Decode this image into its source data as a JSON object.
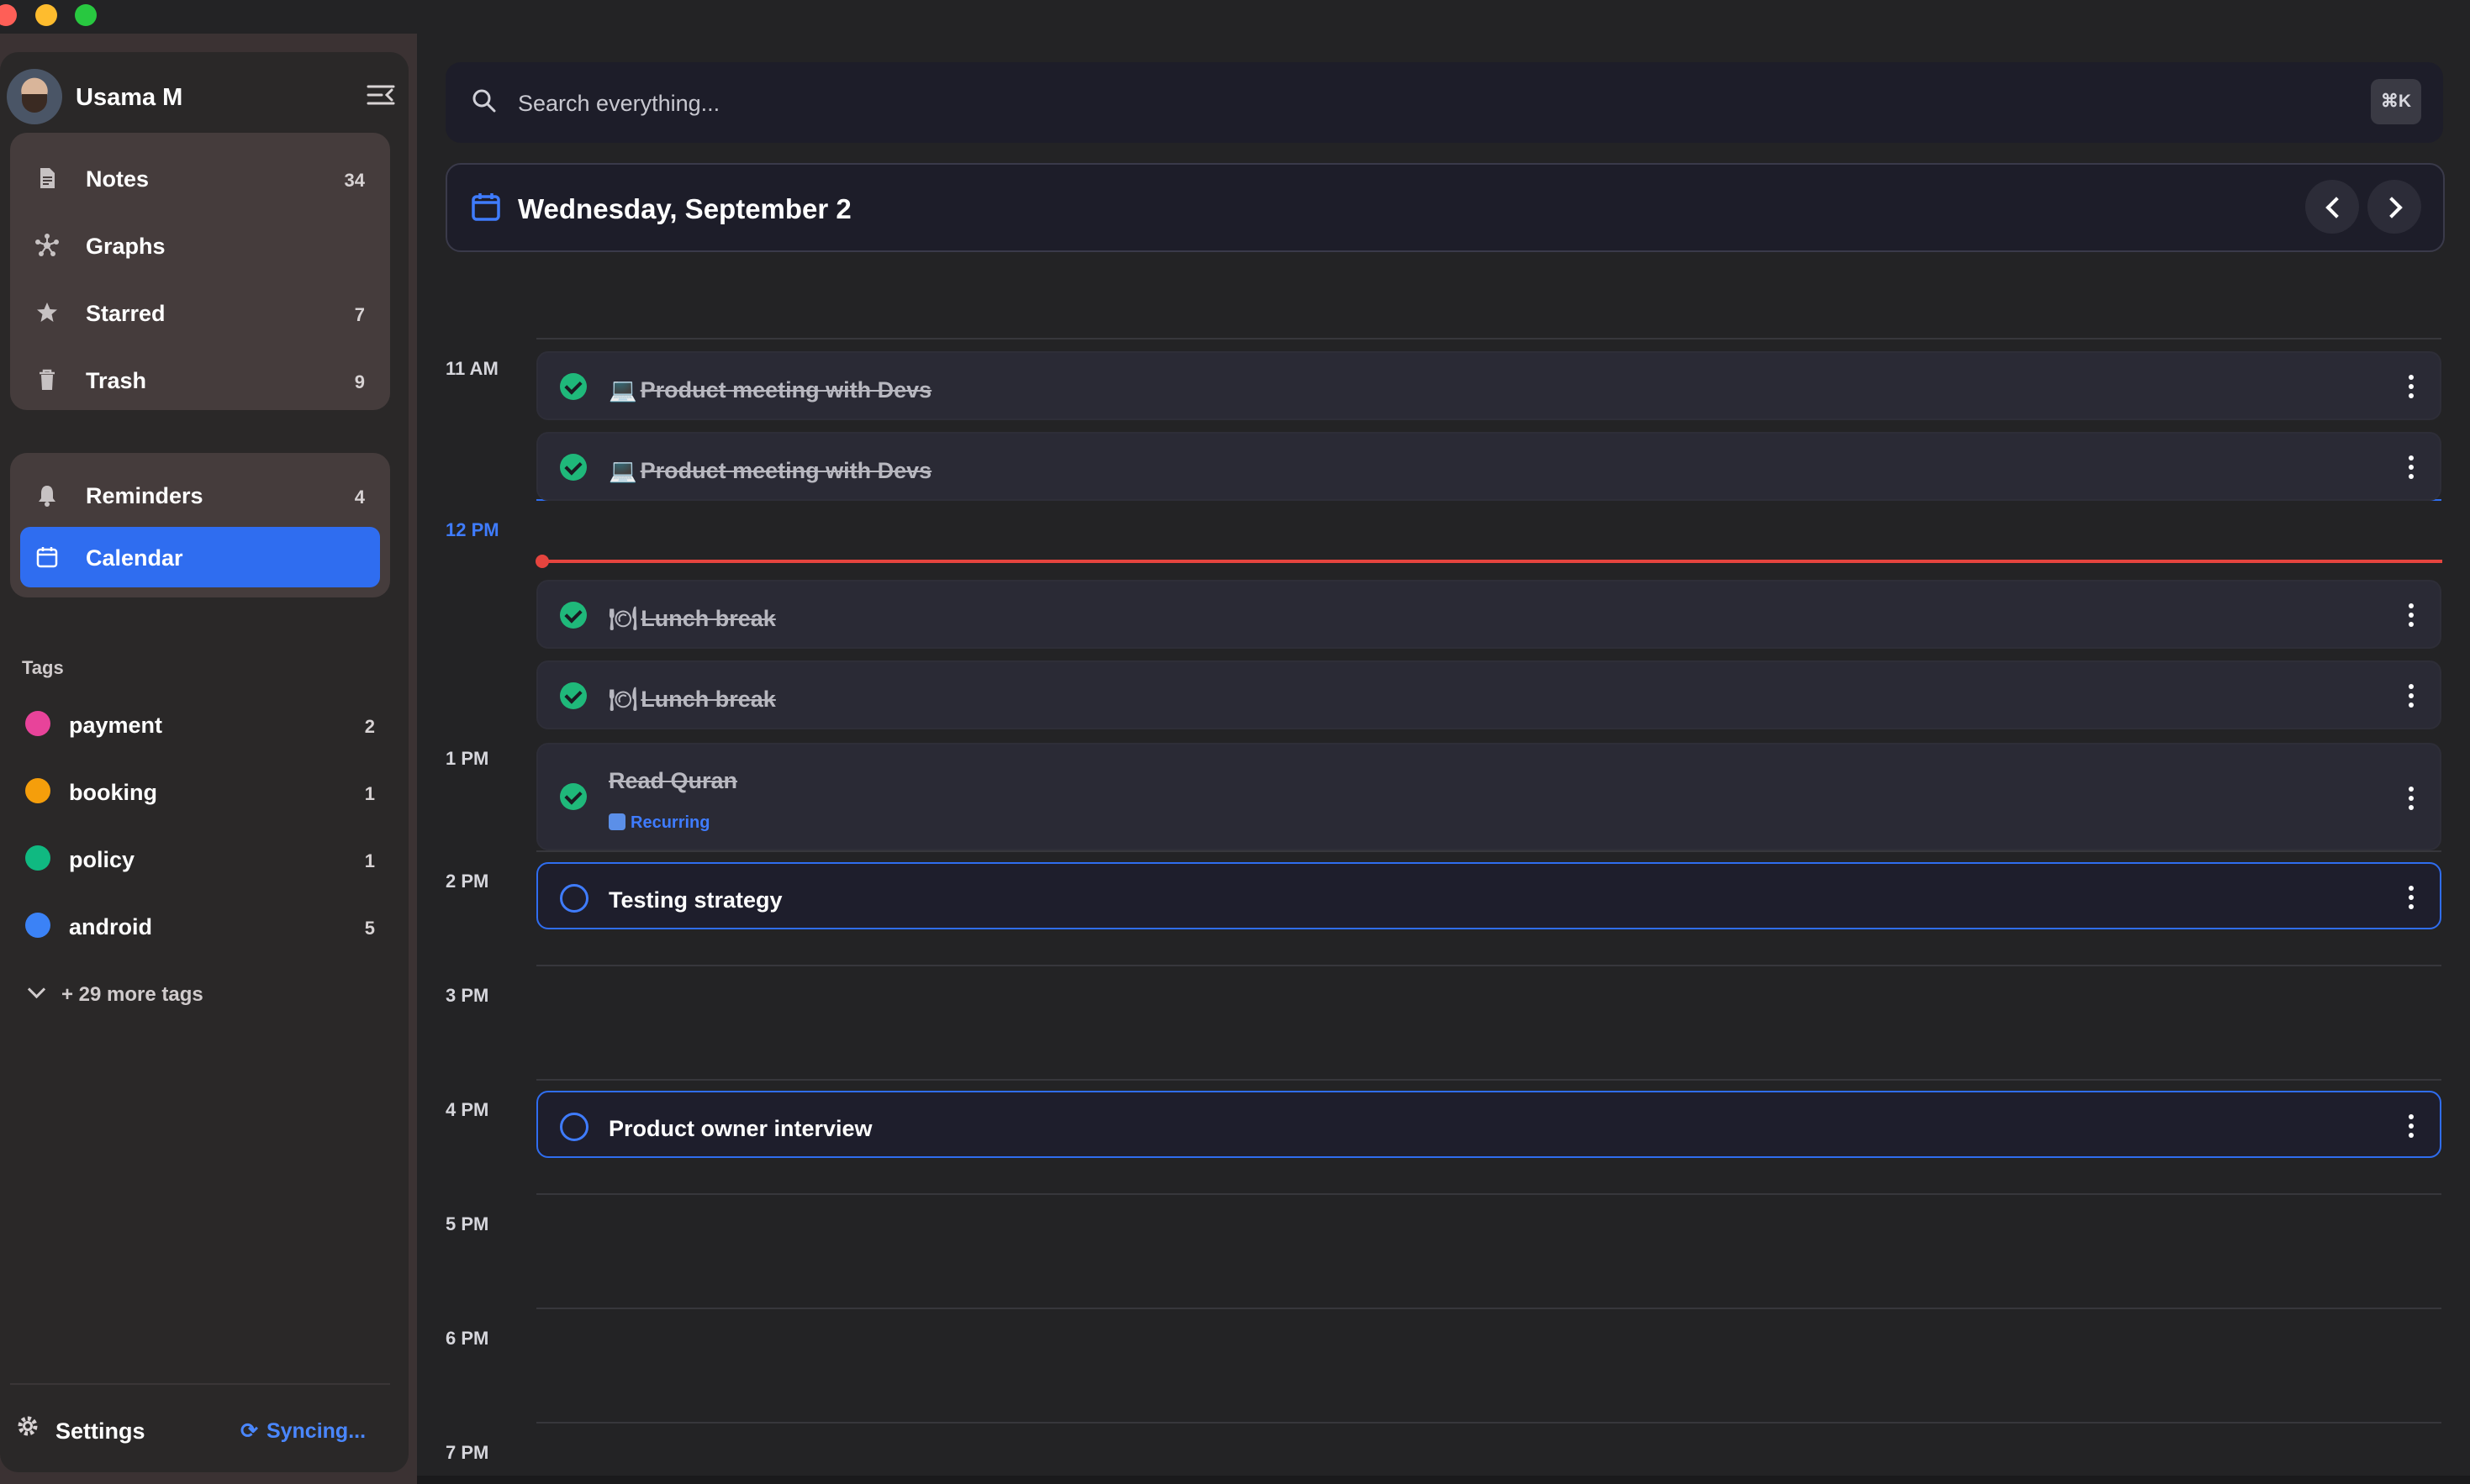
{
  "sidebar": {
    "user": {
      "name": "Usama M"
    },
    "nav_primary": [
      {
        "label": "Notes",
        "count": "34",
        "icon": "document-icon"
      },
      {
        "label": "Graphs",
        "count": "",
        "icon": "graph-icon"
      },
      {
        "label": "Starred",
        "count": "7",
        "icon": "star-icon"
      },
      {
        "label": "Trash",
        "count": "9",
        "icon": "trash-icon"
      }
    ],
    "nav_secondary": [
      {
        "label": "Reminders",
        "count": "4",
        "icon": "bell-icon"
      },
      {
        "label": "Calendar",
        "count": "",
        "icon": "calendar-icon",
        "active": true
      }
    ],
    "tags_title": "Tags",
    "tags": [
      {
        "label": "payment",
        "count": "2",
        "color": "#e8439a"
      },
      {
        "label": "booking",
        "count": "1",
        "color": "#f59e0b"
      },
      {
        "label": "policy",
        "count": "1",
        "color": "#10b981"
      },
      {
        "label": "android",
        "count": "5",
        "color": "#3b82f6"
      }
    ],
    "more_tags": "+ 29 more tags",
    "settings_label": "Settings",
    "sync_status": "Syncing..."
  },
  "search": {
    "placeholder": "Search everything...",
    "shortcut": "⌘K"
  },
  "calendar": {
    "date_title": "Wednesday, September 2",
    "hours": [
      "11 AM",
      "12 PM",
      "1 PM",
      "2 PM",
      "3 PM",
      "4 PM",
      "5 PM",
      "6 PM",
      "7 PM"
    ],
    "current_hour": "12 PM",
    "events": [
      {
        "emoji": "💻",
        "title": "Product meeting with Devs",
        "done": true
      },
      {
        "emoji": "💻",
        "title": "Product meeting with Devs",
        "done": true
      },
      {
        "emoji": "🍽",
        "title": "Lunch break",
        "done": true
      },
      {
        "emoji": "🍽",
        "title": "Lunch break",
        "done": true
      },
      {
        "emoji": "",
        "title": "Read Quran",
        "done": true,
        "tag": "Recurring"
      },
      {
        "emoji": "",
        "title": "Testing strategy",
        "done": false
      },
      {
        "emoji": "",
        "title": "Product owner interview",
        "done": false
      }
    ]
  },
  "colors": {
    "accent": "#2f6df0",
    "done": "#1fb87a",
    "now_line": "#e5443e"
  }
}
